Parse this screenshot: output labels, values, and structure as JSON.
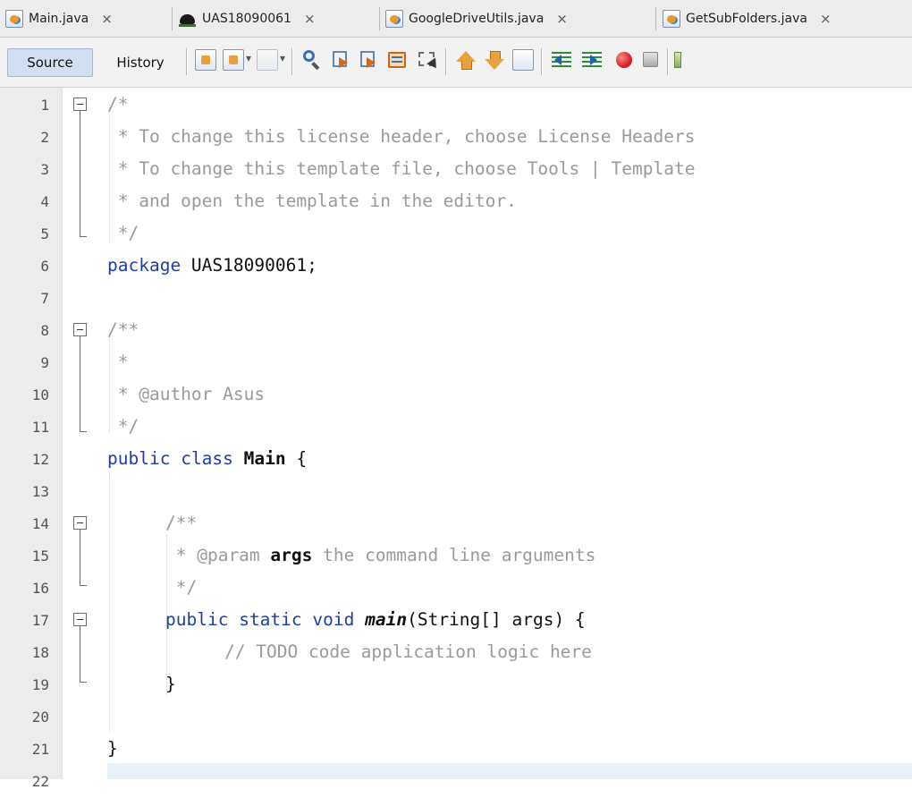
{
  "tabs": [
    {
      "label": "Main.java",
      "icon": "java-file-icon",
      "close": "×"
    },
    {
      "label": "UAS18090061",
      "icon": "project-icon",
      "close": "×"
    },
    {
      "label": "GoogleDriveUtils.java",
      "icon": "java-file-icon",
      "close": "×"
    },
    {
      "label": "GetSubFolders.java",
      "icon": "java-file-icon",
      "close": "×"
    }
  ],
  "toolbar": {
    "source_label": "Source",
    "history_label": "History"
  },
  "lines": [
    {
      "n": "1"
    },
    {
      "n": "2"
    },
    {
      "n": "3"
    },
    {
      "n": "4"
    },
    {
      "n": "5"
    },
    {
      "n": "6"
    },
    {
      "n": "7"
    },
    {
      "n": "8"
    },
    {
      "n": "9"
    },
    {
      "n": "10"
    },
    {
      "n": "11"
    },
    {
      "n": "12"
    },
    {
      "n": "13"
    },
    {
      "n": "14"
    },
    {
      "n": "15"
    },
    {
      "n": "16"
    },
    {
      "n": "17"
    },
    {
      "n": "18"
    },
    {
      "n": "19"
    },
    {
      "n": "20"
    },
    {
      "n": "21"
    },
    {
      "n": "22"
    }
  ],
  "code": {
    "l1": "/*",
    "l2": " * To change this license header, choose License Headers",
    "l3": " * To change this template file, choose Tools | Template",
    "l4": " * and open the template in the editor.",
    "l5": " */",
    "l6_kw": "package",
    "l6_rest": " UAS18090061;",
    "l8": "/**",
    "l9": " *",
    "l10": " * @author Asus",
    "l11": " */",
    "l12_kw1": "public",
    "l12_kw2": "class",
    "l12_name": "Main",
    "l12_rest": " {",
    "l14": "/**",
    "l15_a": " * @param ",
    "l15_b": "args",
    "l15_c": " the command line arguments",
    "l16": " */",
    "l17_kw1": "public",
    "l17_kw2": "static",
    "l17_kw3": "void",
    "l17_name": "main",
    "l17_rest": "(String[] args) {",
    "l18": "// TODO code application logic here",
    "l19": "}",
    "l21": "}"
  },
  "colors": {
    "keyword": "#1e3ea6",
    "comment": "#9a9a9a",
    "gutter": "#ececec",
    "toolbar_active": "#d2dff0"
  }
}
